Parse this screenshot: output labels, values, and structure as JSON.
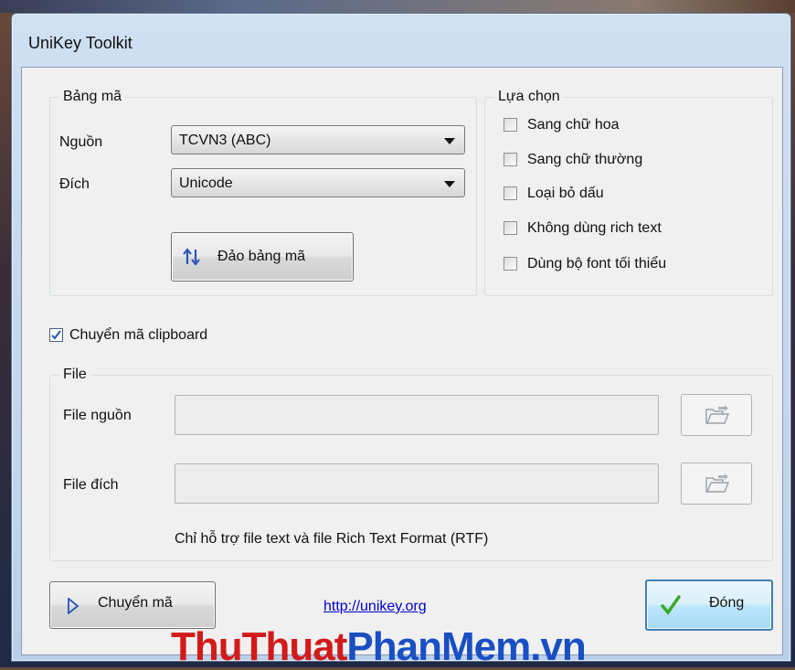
{
  "window": {
    "title": "UniKey Toolkit"
  },
  "encoding_group": {
    "legend": "Bảng mã",
    "source_label": "Nguồn",
    "source_value": "TCVN3 (ABC)",
    "dest_label": "Đích",
    "dest_value": "Unicode",
    "swap_button": "Đảo bảng mã"
  },
  "options_group": {
    "legend": "Lựa chọn",
    "items": [
      {
        "label": "Sang chữ hoa",
        "checked": false
      },
      {
        "label": "Sang chữ thường",
        "checked": false
      },
      {
        "label": "Loại bỏ dấu",
        "checked": false
      },
      {
        "label": "Không dùng rich text",
        "checked": false
      },
      {
        "label": "Dùng bộ font tối thiểu",
        "checked": false
      }
    ]
  },
  "clipboard": {
    "label": "Chuyển mã clipboard",
    "checked": true
  },
  "file_group": {
    "legend": "File",
    "source_label": "File nguồn",
    "source_value": "",
    "dest_label": "File đích",
    "dest_value": "",
    "note": "Chỉ hỗ trợ file text và file Rich Text Format (RTF)"
  },
  "footer": {
    "convert_button": "Chuyển mã",
    "link": "http://unikey.org",
    "close_button": "Đóng"
  },
  "watermark": {
    "part1": "ThuThuat",
    "part2": "PhanMem.vn"
  },
  "colors": {
    "accent_check": "#2f5fb0",
    "link": "#0000cc",
    "close_check": "#3aa829"
  }
}
